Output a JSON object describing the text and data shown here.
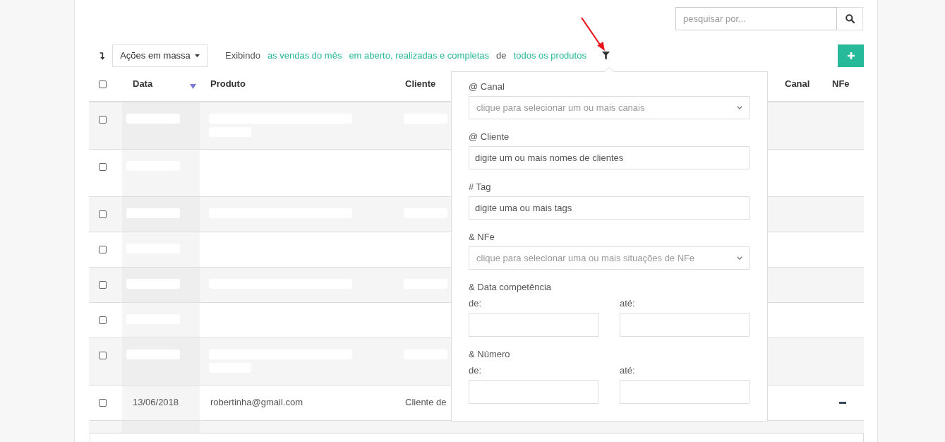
{
  "search": {
    "placeholder": "pesquisar por..."
  },
  "toolbar": {
    "bulk_actions": {
      "label": "Ações em massa"
    },
    "summary": [
      {
        "kind": "text",
        "text": "Exibindo"
      },
      {
        "kind": "link",
        "text": "as vendas do mês"
      },
      {
        "kind": "link",
        "text": "em aberto, realizadas e completas"
      },
      {
        "kind": "text",
        "text": "de"
      },
      {
        "kind": "link",
        "text": "todos os produtos"
      }
    ]
  },
  "table": {
    "select_all": {
      "checked": false
    },
    "columns": [
      {
        "label": "Data",
        "sorted": true
      },
      {
        "label": "Produto",
        "sorted": false
      },
      {
        "label": "Cliente",
        "sorted": false
      },
      {
        "label": "Canal",
        "sorted": false
      },
      {
        "label": "NFe",
        "sorted": false
      }
    ],
    "rows": [
      {
        "kind": "redacted",
        "checked": false,
        "wrapped": true
      },
      {
        "kind": "redacted",
        "checked": false,
        "wrapped": true
      },
      {
        "kind": "redacted",
        "checked": false,
        "wrapped": false
      },
      {
        "kind": "redacted",
        "checked": false,
        "wrapped": false
      },
      {
        "kind": "redacted",
        "checked": false,
        "wrapped": false
      },
      {
        "kind": "redacted",
        "checked": false,
        "wrapped": false
      },
      {
        "kind": "redacted",
        "checked": false,
        "wrapped": true
      },
      {
        "kind": "sale",
        "checked": false,
        "wrapped": false,
        "date": "13/06/2018",
        "product": "robertinha@gmail.com",
        "client": "Cliente de"
      }
    ]
  },
  "filter_panel": {
    "fields": [
      {
        "kind": "select",
        "label": "@ Canal",
        "placeholder": "clique para selecionar um ou mais canais"
      },
      {
        "kind": "tags",
        "label": "@ Cliente",
        "placeholder": "digite um ou mais nomes de clientes"
      },
      {
        "kind": "tags",
        "label": "# Tag",
        "placeholder": "digite uma ou mais tags"
      },
      {
        "kind": "select",
        "label": "& NFe",
        "placeholder": "clique para selecionar uma ou mais situações de NFe"
      },
      {
        "kind": "range",
        "label": "& Data competência",
        "from_label": "de:",
        "to_label": "até:"
      },
      {
        "kind": "range",
        "label": "& Número",
        "from_label": "de:",
        "to_label": "até:"
      }
    ]
  }
}
